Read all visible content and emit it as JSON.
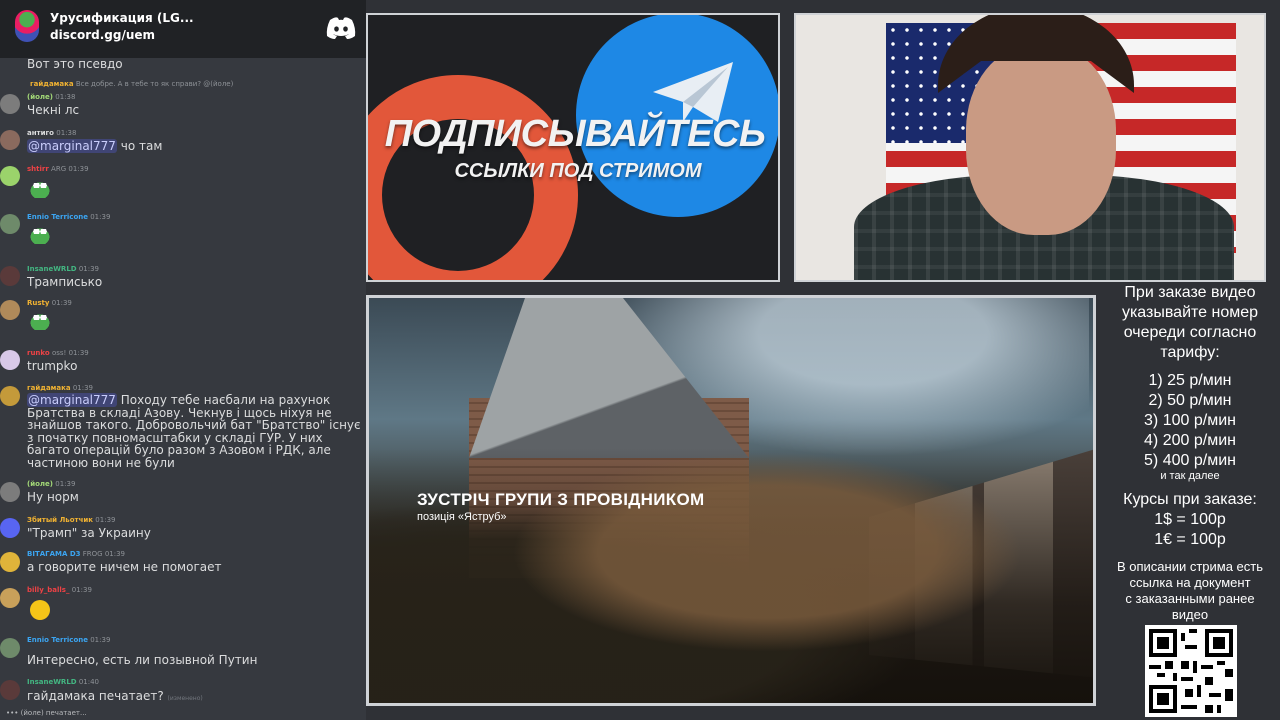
{
  "discord": {
    "server_name": "Урусификация (LG...",
    "invite_link": "discord.gg/uem"
  },
  "chat": {
    "partial_top": "Вот это псевдо",
    "messages": [
      {
        "nick": "гайдамака",
        "time": "",
        "text": "Все добре. А в тебе то як справи? @(йоле)",
        "reply": true,
        "nick_color": "#f0b232"
      },
      {
        "nick": "(йоле)",
        "time": "01:38",
        "text": "Чекні лс",
        "nick_color": "#a3d977"
      },
      {
        "nick": "антиго",
        "time": "01:38",
        "mention": "@marginal777",
        "text": "чо там",
        "nick_color": "#dcddde"
      },
      {
        "nick": "shtirr",
        "badge": "ARG",
        "time": "01:39",
        "text": "",
        "emoji": "frog",
        "nick_color": "#ed4245"
      },
      {
        "nick": "Ennio Terricone",
        "time": "01:39",
        "text": "",
        "emoji": "frog",
        "nick_color": "#3ba5f2"
      },
      {
        "nick": "InsaneWRLD",
        "time": "01:39",
        "text": "Трамписько",
        "nick_color": "#43b581"
      },
      {
        "nick": "Rusty",
        "time": "01:39",
        "text": "",
        "emoji": "frog",
        "nick_color": "#f0b232"
      },
      {
        "nick": "runko",
        "badge": "oss!",
        "time": "01:39",
        "text": "trumpko",
        "nick_color": "#ed4245"
      },
      {
        "nick": "гайдамака",
        "time": "01:39",
        "mention": "@marginal777",
        "text": "Походу тебе наєбали на рахунок Братства в складі Азову. Чекнув і щось ніхуя не знайшов такого. Добровольчий бат \"Братство\" існує з початку повномасштабки у складі ГУР. У них багато операцій було разом з Азовом і РДК, але частиною вони не були",
        "nick_color": "#f0b232"
      },
      {
        "nick": "(йоле)",
        "time": "01:39",
        "text": "Ну норм",
        "nick_color": "#a3d977"
      },
      {
        "nick": "Збитый Льотчик",
        "time": "01:39",
        "text": "\"Трамп\" за Украину",
        "nick_color": "#f0b232"
      },
      {
        "nick": "ВІТАГАМА D3",
        "badge": "FROG",
        "time": "01:39",
        "text": "а говорите ничем не помогает",
        "nick_color": "#3ba5f2"
      },
      {
        "nick": "billy_balls_",
        "time": "01:39",
        "text": "",
        "emoji": "yellow",
        "nick_color": "#ed4245"
      },
      {
        "nick": "Ennio Terricone",
        "time": "01:39",
        "text": "Интересно, есть ли позывной Путин",
        "nick_color": "#3ba5f2"
      },
      {
        "nick": "InsaneWRLD",
        "time": "01:40",
        "text": "гайдамака печатает?",
        "edited": "(изменено)",
        "nick_color": "#43b581"
      }
    ],
    "typing": "(йоле) печатает..."
  },
  "promo": {
    "title": "ПОДПИСЫВАЙТЕСЬ",
    "subtitle": "ССЫЛКИ ПОД СТРИМОМ"
  },
  "video": {
    "title": "ЗУСТРІЧ ГРУПИ З ПРОВІДНИКОМ",
    "subtitle": "позиція «Яструб»"
  },
  "info": {
    "heading": [
      "При заказе видео",
      "указывайте номер",
      "очереди согласно",
      "тарифу:"
    ],
    "tariffs": [
      "1) 25 р/мин",
      "2) 50 р/мин",
      "3) 100 р/мин",
      "4) 200 р/мин",
      "5) 400 р/мин"
    ],
    "etc": "и так далее",
    "rates_heading": "Курсы при заказе:",
    "rates": [
      "1$ = 100р",
      "1€ = 100р"
    ],
    "note": [
      "В описании стрима есть",
      "ссылка на документ",
      "с заказанными ранее",
      "видео"
    ]
  }
}
